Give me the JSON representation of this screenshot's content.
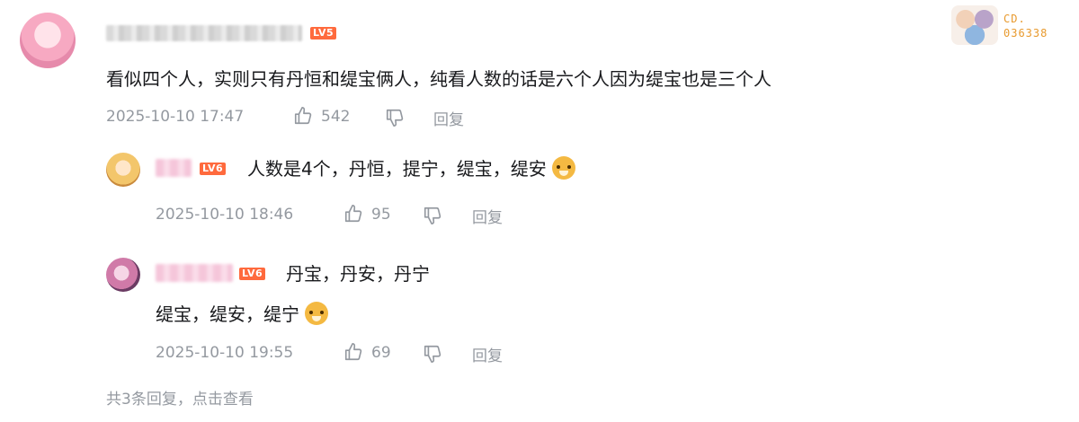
{
  "top_comment": {
    "level": "LV5",
    "text": "看似四个人，实则只有丹恒和缇宝俩人，纯看人数的话是六个人因为缇宝也是三个人",
    "time": "2025-10-10 17:47",
    "likes": "542",
    "reply": "回复"
  },
  "badge": {
    "line1": "CD.",
    "line2": "036338"
  },
  "replies": [
    {
      "level": "LV6",
      "text": "人数是4个，丹恒，提宁，缇宝，缇安",
      "time": "2025-10-10 18:46",
      "likes": "95",
      "reply": "回复"
    },
    {
      "level": "LV6",
      "text_line1": "丹宝，丹安，丹宁",
      "text_line2": "缇宝，缇安，缇宁",
      "time": "2025-10-10 19:55",
      "likes": "69",
      "reply": "回复"
    }
  ],
  "footer": {
    "summary": "共3条回复，点击查看"
  },
  "icons": {
    "like": "thumbs-up-icon",
    "dislike": "thumbs-down-icon",
    "emoji": "doge-emoji-icon"
  },
  "colors": {
    "level_badge": "#ff6a3d",
    "meta_text": "#9499a0",
    "badge_text": "#e89a2e"
  }
}
